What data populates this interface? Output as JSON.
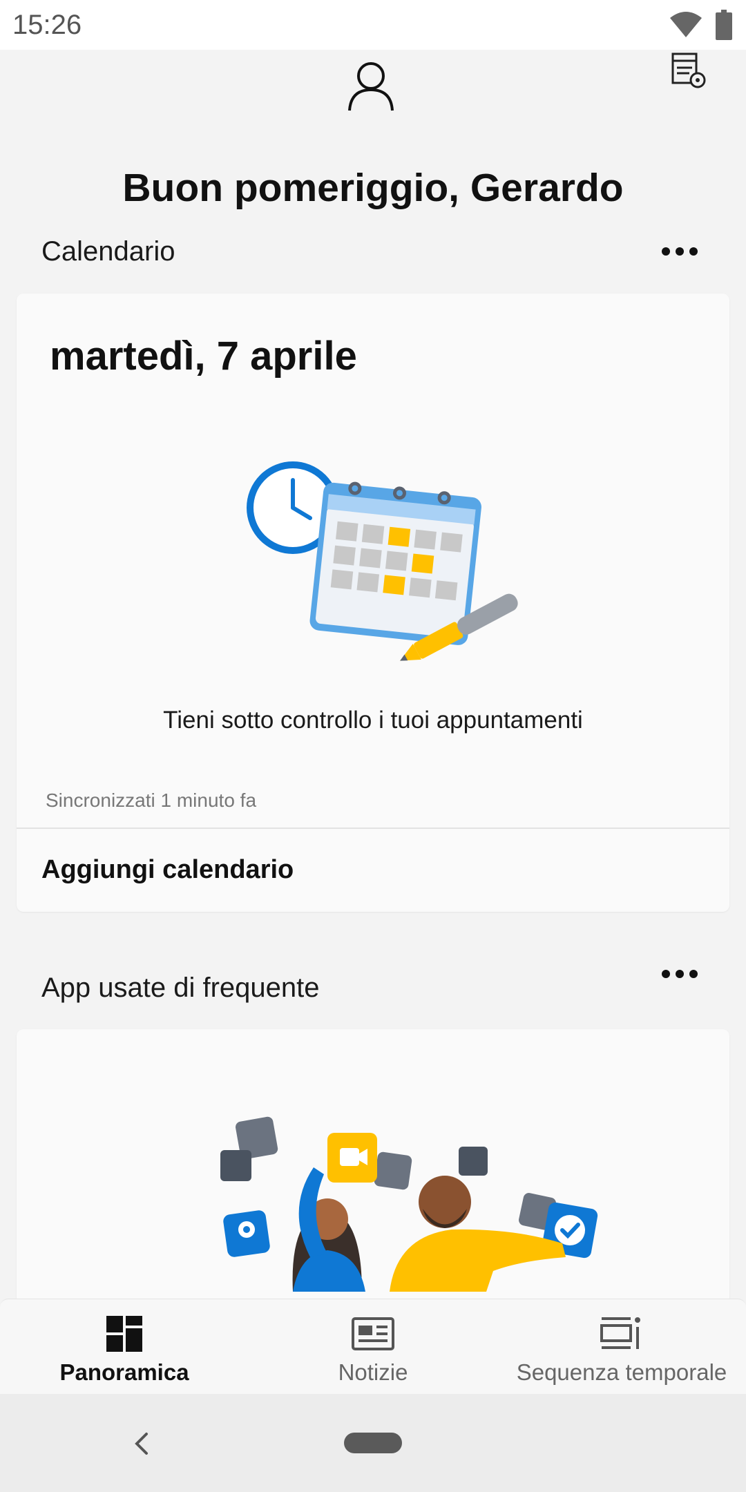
{
  "status_bar": {
    "time": "15:26"
  },
  "header": {
    "greeting": "Buon pomeriggio, Gerardo"
  },
  "calendar": {
    "section_title": "Calendario",
    "date": "martedì, 7 aprile",
    "empty_message": "Tieni sotto controllo i tuoi appuntamenti",
    "sync_status": "Sincronizzati 1 minuto fa",
    "add_calendar": "Aggiungi calendario"
  },
  "apps": {
    "section_title": "App usate di frequente"
  },
  "tabs": [
    {
      "label": "Panoramica",
      "icon": "dashboard-icon",
      "active": true
    },
    {
      "label": "Notizie",
      "icon": "news-icon",
      "active": false
    },
    {
      "label": "Sequenza temporale",
      "icon": "timeline-icon",
      "active": false
    }
  ],
  "colors": {
    "accent_blue": "#0f78d4",
    "calendar_blue": "#58a6e6",
    "yellow": "#ffc000",
    "gray_tile": "#c8c8c8",
    "dark_tile": "#4a5360"
  },
  "icons": {
    "profile": "person-icon",
    "settings": "feed-settings-icon",
    "more": "more-horizontal-icon",
    "back": "back-chevron-icon"
  }
}
